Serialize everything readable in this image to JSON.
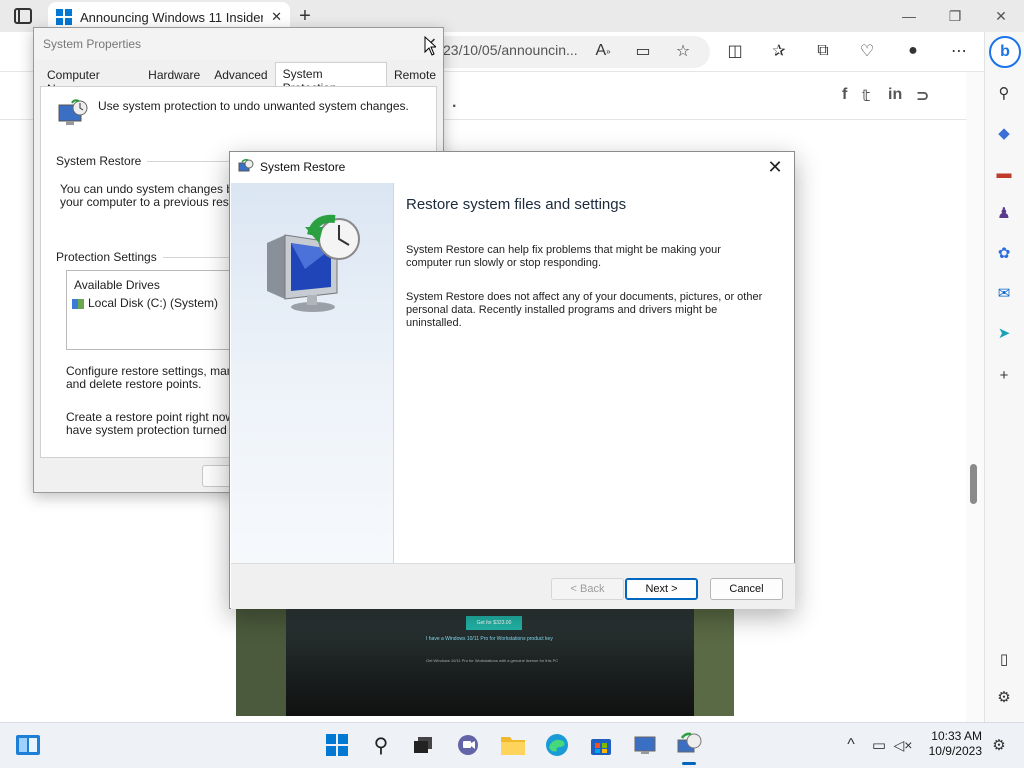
{
  "browser": {
    "tab_title": "Announcing Windows 11 Insider",
    "tab_close": "✕",
    "new_tab": "+",
    "url": "23/10/05/announcin...",
    "window_controls": {
      "minimize": "—",
      "restore": "❐",
      "close": "✕"
    },
    "page_dot": "."
  },
  "banner": {
    "cta": "Get for $323.00",
    "line1": "I have a Windows 10/11 Pro for Workstations product key",
    "line2": "Get Windows 10/11 Pro for Workstations with a genuine license for this PC"
  },
  "system_properties": {
    "title": "System Properties",
    "tabs": [
      "Computer Name",
      "Hardware",
      "Advanced",
      "System Protection",
      "Remote"
    ],
    "active_tab": "System Protection",
    "intro": "Use system protection to undo unwanted system changes.",
    "system_restore_group": "System Restore",
    "restore_text_1": "You can undo system changes by re",
    "restore_text_2": "your computer to a previous restore p",
    "protection_group": "Protection Settings",
    "drives_header": "Available Drives",
    "drive_item": "Local Disk (C:) (System)",
    "configure_text_1": "Configure restore settings, manage",
    "configure_text_2": "and delete restore points.",
    "create_text_1": "Create a restore point right now for",
    "create_text_2": "have system protection turned on."
  },
  "wizard": {
    "title": "System Restore",
    "close": "✕",
    "heading": "Restore system files and settings",
    "para1": "System Restore can help fix problems that might be making your computer run slowly or stop responding.",
    "para2": "System Restore does not affect any of your documents, pictures, or other personal data. Recently installed programs and drivers might be uninstalled.",
    "back": "< Back",
    "next": "Next >",
    "cancel": "Cancel"
  },
  "taskbar": {
    "time": "10:33 AM",
    "date": "10/9/2023",
    "chevron": "^"
  },
  "colors": {
    "accent": "#0067c0",
    "edge_blue": "#1a73e8"
  }
}
